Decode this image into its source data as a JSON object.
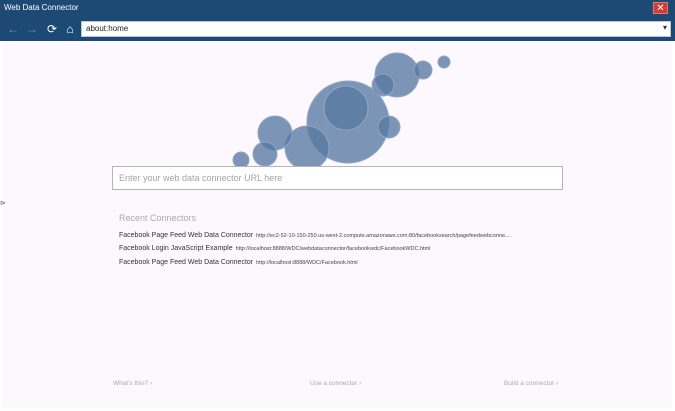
{
  "window": {
    "title": "Web Data Connector",
    "close_label": "✕"
  },
  "nav": {
    "back_icon": "←",
    "forward_icon": "→",
    "refresh_icon": "⟳",
    "home_icon": "⌂",
    "address_value": "about:home",
    "address_caret": "▾"
  },
  "search": {
    "placeholder": "Enter your web data connector URL here"
  },
  "recent": {
    "heading": "Recent Connectors",
    "items": [
      {
        "name": "Facebook Page Feed Web Data Connector",
        "url": "http://ec2-52-10-150-250.us-west-2.compute.amazonaws.com:80/facebooksearch/pagefeedwebconne...."
      },
      {
        "name": "Facebook Login JavaScript Example",
        "url": "http://localhost:8888/WDC/webdataconnector/facebookwdc/FacebookWDC.html"
      },
      {
        "name": "Facebook Page Feed Web Data Connector",
        "url": "http://localhost:8888/WDC/Facebook.html"
      }
    ]
  },
  "footer": {
    "whats_this": "What's this? ›",
    "use_connector": "Use a connector ›",
    "build_connector": "Build a connector ›"
  },
  "colors": {
    "titlebar": "#1d4a74",
    "bubble_fill": "#5779a3",
    "bubble_stroke": "#8ea5c2",
    "content_bg": "#fdf8fd"
  }
}
